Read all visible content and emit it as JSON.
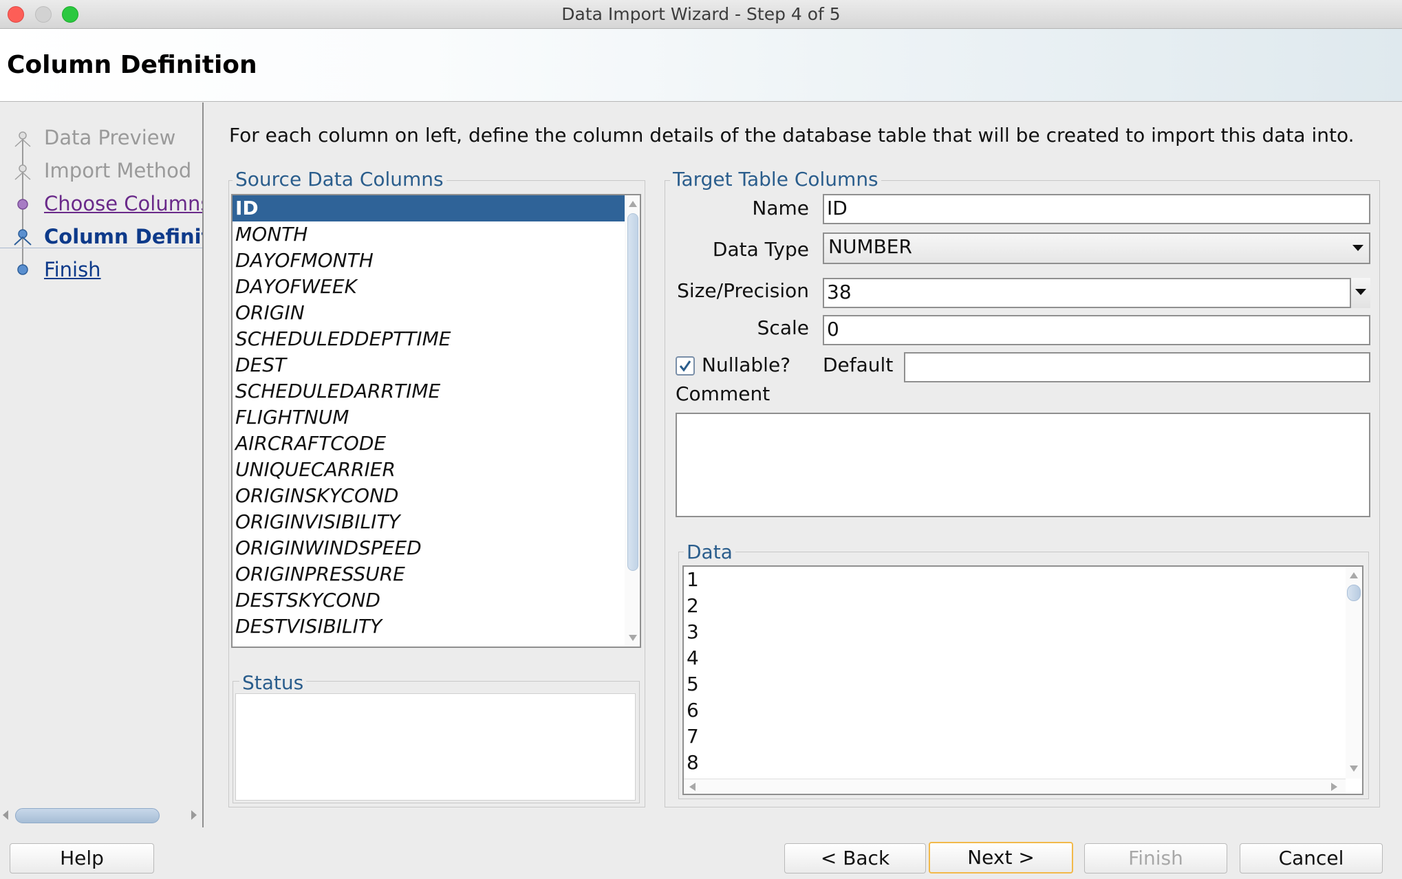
{
  "window": {
    "title": "Data Import Wizard - Step 4 of 5"
  },
  "header": {
    "title": "Column Definition"
  },
  "sidebar": {
    "steps": [
      {
        "label": "Data Preview",
        "state": "disabled"
      },
      {
        "label": "Import Method",
        "state": "disabled"
      },
      {
        "label": "Choose Columns",
        "state": "visited"
      },
      {
        "label": "Column Definiti",
        "state": "current"
      },
      {
        "label": "Finish",
        "state": "link"
      }
    ]
  },
  "main": {
    "instruction": "For each column on left, define the column details of the database table that will be created to import this data into.",
    "source": {
      "legend": "Source Data Columns",
      "columns": [
        "ID",
        "MONTH",
        "DAYOFMONTH",
        "DAYOFWEEK",
        "ORIGIN",
        "SCHEDULEDDEPTTIME",
        "DEST",
        "SCHEDULEDARRTIME",
        "FLIGHTNUM",
        "AIRCRAFTCODE",
        "UNIQUECARRIER",
        "ORIGINSKYCOND",
        "ORIGINVISIBILITY",
        "ORIGINWINDSPEED",
        "ORIGINPRESSURE",
        "DESTSKYCOND",
        "DESTVISIBILITY"
      ],
      "selected": "ID"
    },
    "status": {
      "legend": "Status"
    },
    "target": {
      "legend": "Target Table Columns",
      "name_label": "Name",
      "name_value": "ID",
      "datatype_label": "Data Type",
      "datatype_value": "NUMBER",
      "size_label": "Size/Precision",
      "size_value": "38",
      "scale_label": "Scale",
      "scale_value": "0",
      "nullable_label": "Nullable?",
      "nullable_checked": true,
      "default_label": "Default",
      "default_value": "",
      "comment_label": "Comment",
      "comment_value": ""
    },
    "data": {
      "legend": "Data",
      "rows": [
        "1",
        "2",
        "3",
        "4",
        "5",
        "6",
        "7",
        "8"
      ]
    }
  },
  "buttons": {
    "help": "Help",
    "back": "< Back",
    "next": "Next >",
    "finish": "Finish",
    "cancel": "Cancel"
  },
  "colors": {
    "selection": "#2f6398",
    "legend": "#2a5d8c",
    "default_button_border": "#f2b94a"
  }
}
